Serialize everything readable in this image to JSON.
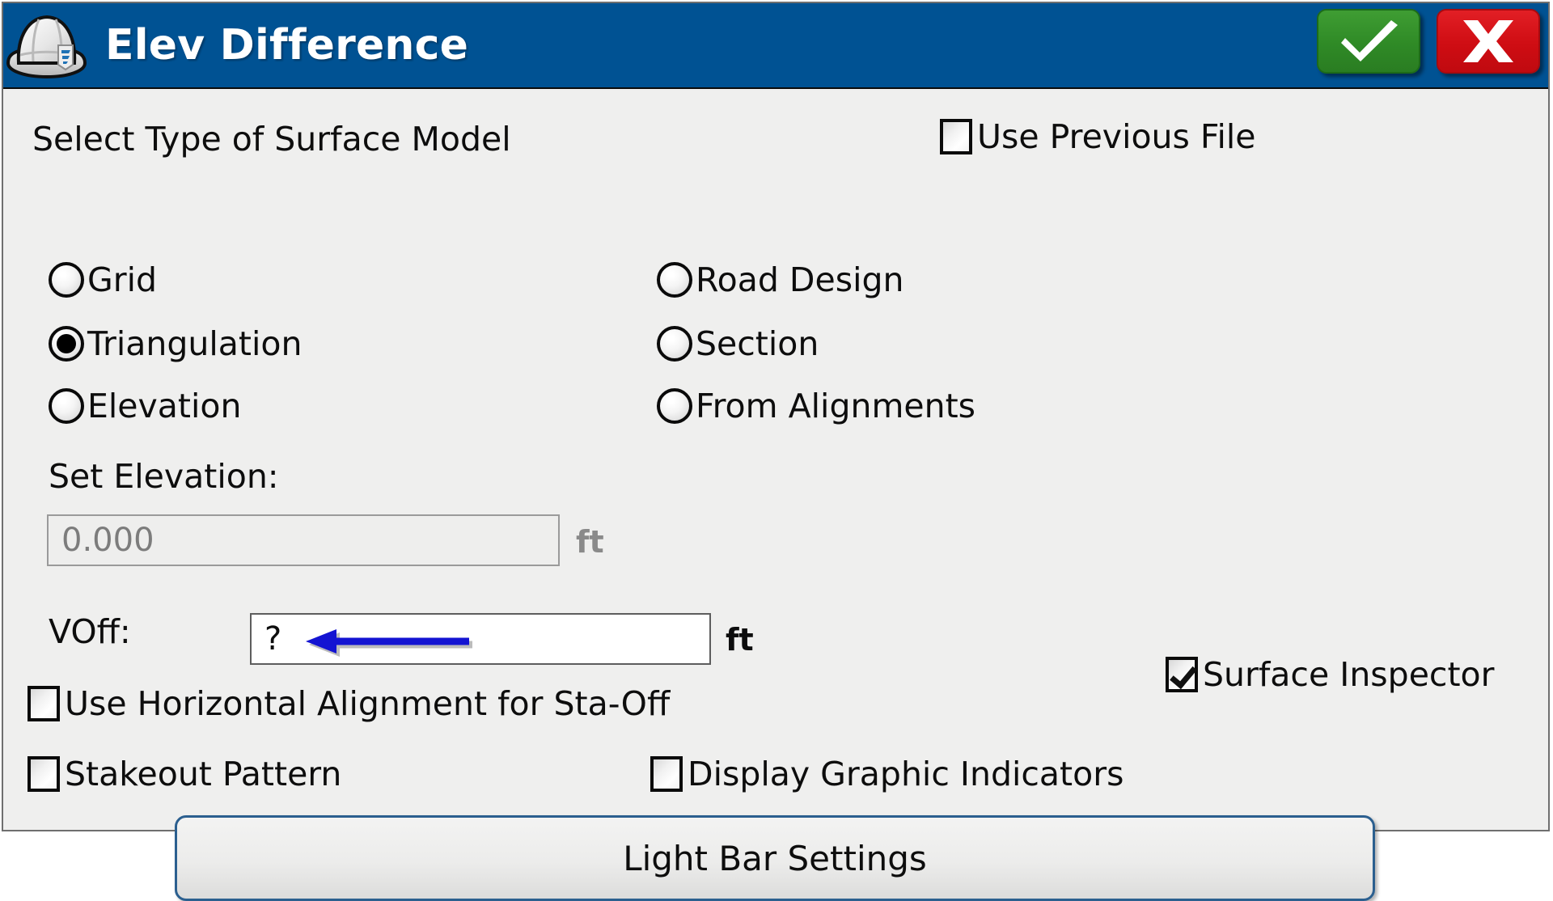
{
  "window": {
    "title": "Elev Difference",
    "icon": "hard-hat-icon",
    "accent_color": "#005293",
    "background_color": "#efefee"
  },
  "titlebar": {
    "ok_label": "✔",
    "ok_color": "#2f8a26",
    "cancel_label": "X",
    "cancel_color": "#cf0d13"
  },
  "form": {
    "section_label": "Select Type of Surface Model",
    "use_previous_file": {
      "label": "Use Previous File",
      "checked": false
    },
    "surface_model_options": [
      {
        "label": "Grid",
        "selected": false
      },
      {
        "label": "Triangulation",
        "selected": true
      },
      {
        "label": "Elevation",
        "selected": false
      },
      {
        "label": "Road Design",
        "selected": false
      },
      {
        "label": "Section",
        "selected": false
      },
      {
        "label": "From Alignments",
        "selected": false
      }
    ],
    "set_elevation": {
      "label": "Set Elevation:",
      "value": "0.000",
      "unit": "ft",
      "enabled": false
    },
    "voff": {
      "label": "VOff:",
      "value": "?",
      "unit": "ft",
      "enabled": true
    },
    "use_horizontal_alignment": {
      "label": "Use Horizontal Alignment for Sta-Off",
      "checked": false
    },
    "surface_inspector": {
      "label": "Surface Inspector",
      "checked": true
    },
    "stakeout_pattern": {
      "label": "Stakeout Pattern",
      "checked": false
    },
    "display_graphic_indicators": {
      "label": "Display Graphic Indicators",
      "checked": false
    },
    "light_bar_settings": {
      "label": "Light Bar Settings"
    }
  },
  "annotation": {
    "type": "arrow",
    "color": "#1414d2",
    "direction": "left",
    "points_to": "voff-input"
  }
}
